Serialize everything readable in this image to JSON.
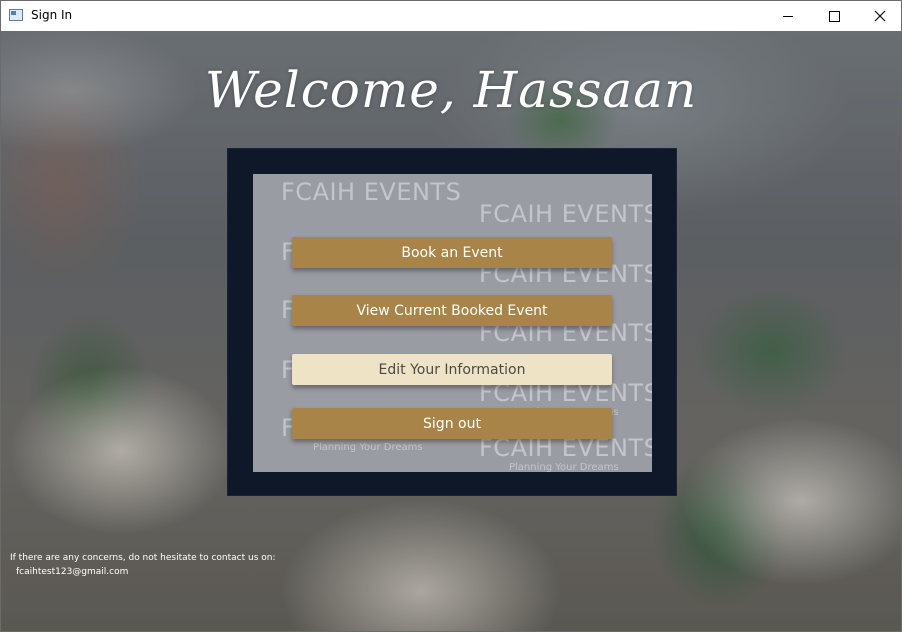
{
  "window": {
    "title": "Sign In",
    "minimize_icon": "minimize-icon",
    "maximize_icon": "maximize-icon",
    "close_icon": "close-icon"
  },
  "greeting": "Welcome, Hassaan",
  "watermark": {
    "brand": "FCAIH EVENTS",
    "tagline": "Planning Your Dreams"
  },
  "menu": {
    "buttons": [
      {
        "label": "Book an Event"
      },
      {
        "label": "View Current Booked Event"
      },
      {
        "label": "Edit Your Information"
      },
      {
        "label": "Sign out"
      }
    ]
  },
  "footer": {
    "contact_text": "If there are any concerns, do not hesitate to contact us on:",
    "email": "fcaihtest123@gmail.com"
  },
  "colors": {
    "button": "#a88449",
    "button_hover": "#efe3c6",
    "panel_frame": "#0f1828",
    "panel_fill": "#9a9ca3"
  }
}
